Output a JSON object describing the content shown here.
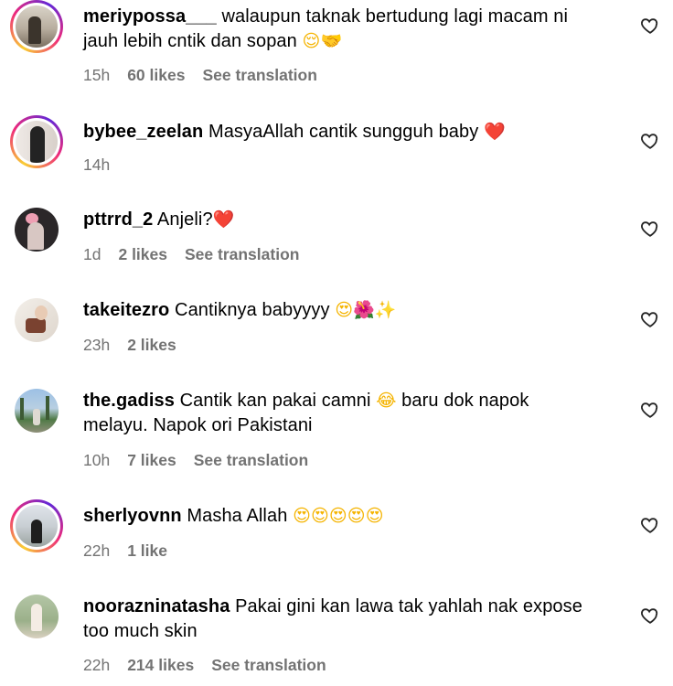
{
  "comments": [
    {
      "username": "meriypossa___",
      "text_line1": " walaupun taknak bertudung lagi macam ni",
      "text_line2": "jauh lebih cntik dan sopan ",
      "emoji": "😌🤝",
      "time": "15h",
      "likes": "60 likes",
      "translation": "See translation",
      "avatar_colors": [
        "#c7bfb1",
        "#4a4035"
      ]
    },
    {
      "username": "bybee_zeelan",
      "text_line1": " MasyaAllah cantik sungguh baby ",
      "emoji": "❤️",
      "time": "14h",
      "avatar_colors": [
        "#e6e0dc",
        "#2a2a2a"
      ]
    },
    {
      "username": "pttrrd_2",
      "text_line1": " Anjeli?",
      "emoji": "❤️",
      "time": "1d",
      "likes": "2 likes",
      "translation": "See translation",
      "avatar_colors": [
        "#2a2528",
        "#e9a3b4"
      ]
    },
    {
      "username": "takeitezro",
      "text_line1": " Cantiknya babyyyy ",
      "emoji": "😍🌺✨",
      "time": "23h",
      "likes": "2 likes",
      "avatar_colors": [
        "#efe9e2",
        "#7b4a34"
      ]
    },
    {
      "username": "the.gadiss",
      "text_line1": " Cantik kan pakai camni ",
      "emoji": "😂",
      "text_line1b": " baru dok napok",
      "text_line2": "melayu. Napok ori Pakistani",
      "time": "10h",
      "likes": "7 likes",
      "translation": "See translation",
      "avatar_colors": [
        "#8fb2d8",
        "#3d6b3a"
      ]
    },
    {
      "username": "sherlyovnn",
      "text_line1": " Masha Allah ",
      "emoji": "😍😍😍😍😍",
      "time": "22h",
      "likes": "1 like",
      "avatar_colors": [
        "#d8dee6",
        "#1e1e1e"
      ]
    },
    {
      "username": "noorazninatasha",
      "text_line1": " Pakai gini kan lawa tak yahlah nak expose",
      "text_line2": "too much skin",
      "time": "22h",
      "likes": "214 likes",
      "translation": "See translation",
      "avatar_colors": [
        "#a7b99a",
        "#f2ebe2"
      ]
    }
  ]
}
